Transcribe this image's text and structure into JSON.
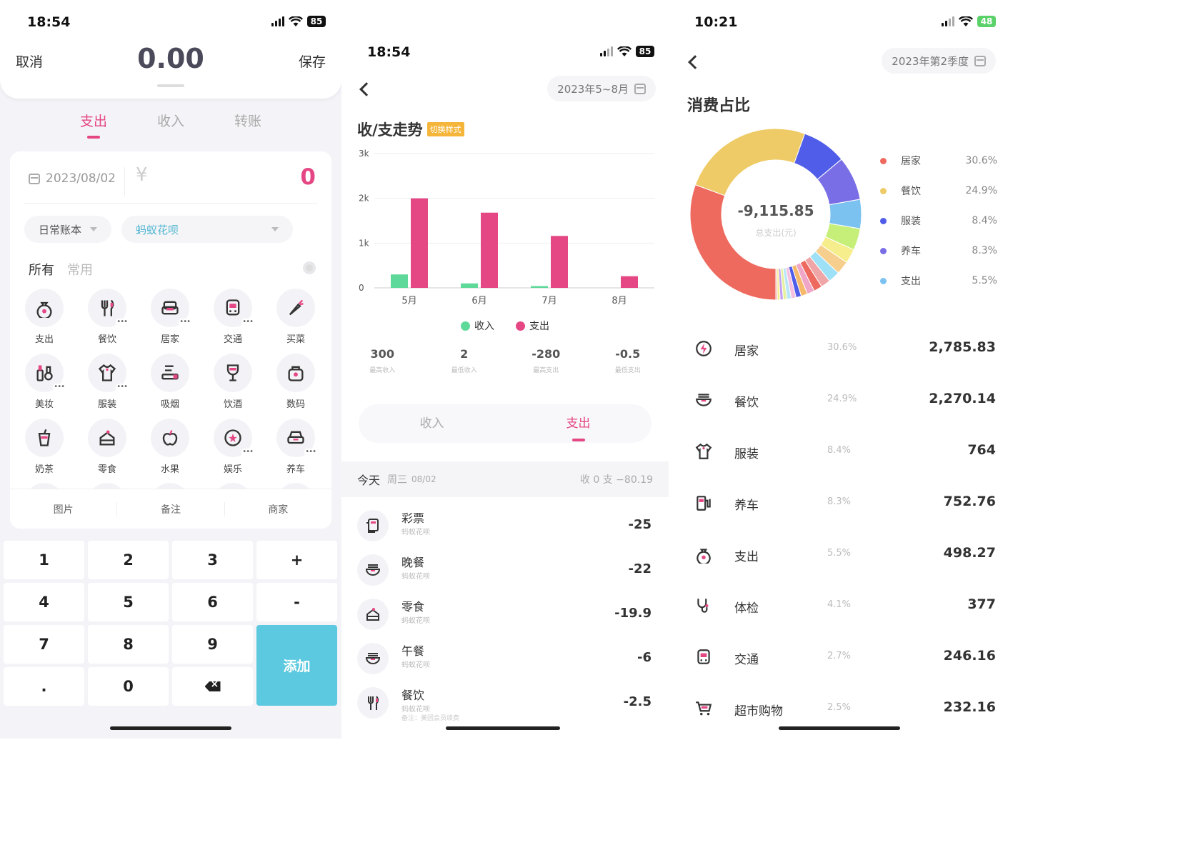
{
  "screen1": {
    "status_time": "18:54",
    "battery": "85",
    "cancel_label": "取消",
    "amount": "0.00",
    "save_label": "保存",
    "tabs": [
      {
        "label": "支出",
        "active": true
      },
      {
        "label": "收入",
        "active": false
      },
      {
        "label": "转账",
        "active": false
      }
    ],
    "date": "2023/08/02",
    "currency_symbol": "¥",
    "entry_value": "0",
    "ledger": "日常账本",
    "account": "蚂蚁花呗",
    "account_color": "#4fb6d0",
    "category_tabs": {
      "all": "所有",
      "common": "常用"
    },
    "categories": [
      {
        "label": "支出",
        "icon": "money-bag-icon",
        "more": false
      },
      {
        "label": "餐饮",
        "icon": "fork-knife-icon",
        "more": true
      },
      {
        "label": "居家",
        "icon": "sofa-icon",
        "more": true
      },
      {
        "label": "交通",
        "icon": "bus-icon",
        "more": true
      },
      {
        "label": "买菜",
        "icon": "carrot-icon",
        "more": false
      },
      {
        "label": "美妆",
        "icon": "cosmetics-icon",
        "more": true
      },
      {
        "label": "服装",
        "icon": "shirt-icon",
        "more": true
      },
      {
        "label": "吸烟",
        "icon": "cigarette-icon",
        "more": false
      },
      {
        "label": "饮酒",
        "icon": "wine-glass-icon",
        "more": false
      },
      {
        "label": "数码",
        "icon": "camera-bag-icon",
        "more": false
      },
      {
        "label": "奶茶",
        "icon": "milk-tea-icon",
        "more": false
      },
      {
        "label": "零食",
        "icon": "cake-icon",
        "more": false
      },
      {
        "label": "水果",
        "icon": "apple-icon",
        "more": false
      },
      {
        "label": "娱乐",
        "icon": "star-circle-icon",
        "more": true
      },
      {
        "label": "养车",
        "icon": "car-icon",
        "more": true
      }
    ],
    "footer": {
      "image": "图片",
      "note": "备注",
      "merchant": "商家"
    },
    "keypad": [
      "1",
      "2",
      "3",
      "+",
      "4",
      "5",
      "6",
      "-",
      "7",
      "8",
      "9",
      ".",
      "0"
    ],
    "add_label": "添加",
    "accent_color": "#e54785"
  },
  "screen2": {
    "status_time": "18:54",
    "battery": "85",
    "date_range": "2023年5~8月",
    "title": "收/支走势",
    "switch_tag": "切换样式",
    "stats": [
      {
        "value": "300",
        "label": "最高收入"
      },
      {
        "value": "2",
        "label": "最低收入"
      },
      {
        "value": "-280",
        "label": "最高支出"
      },
      {
        "value": "-0.5",
        "label": "最低支出"
      }
    ],
    "segments": [
      {
        "label": "收入",
        "active": false
      },
      {
        "label": "支出",
        "active": true
      }
    ],
    "day": {
      "today": "今天",
      "weekday": "周三",
      "date": "08/02",
      "summary": "收 0    支 −80.19"
    },
    "transactions": [
      {
        "name": "彩票",
        "account": "蚂蚁花呗",
        "amount": "-25",
        "icon": "lottery-ticket-icon",
        "note": ""
      },
      {
        "name": "晚餐",
        "account": "蚂蚁花呗",
        "amount": "-22",
        "icon": "bowl-icon",
        "note": ""
      },
      {
        "name": "零食",
        "account": "蚂蚁花呗",
        "amount": "-19.9",
        "icon": "cake-icon",
        "note": ""
      },
      {
        "name": "午餐",
        "account": "蚂蚁花呗",
        "amount": "-6",
        "icon": "bowl-icon",
        "note": ""
      },
      {
        "name": "餐饮",
        "account": "蚂蚁花呗",
        "amount": "-2.5",
        "icon": "fork-knife-icon",
        "note": "备注：美团会员续费"
      }
    ]
  },
  "chart_data": {
    "type": "bar",
    "categories": [
      "5月",
      "6月",
      "7月",
      "8月"
    ],
    "series": [
      {
        "name": "收入",
        "color": "#5fd99a",
        "values": [
          300,
          100,
          40,
          0
        ]
      },
      {
        "name": "支出",
        "color": "#e54785",
        "values": [
          2000,
          1680,
          1160,
          260
        ]
      }
    ],
    "yticks": [
      "0",
      "1k",
      "2k",
      "3k"
    ],
    "ylim": [
      0,
      3000
    ]
  },
  "screen3": {
    "status_time": "10:21",
    "battery": "48",
    "date_range": "2023年第2季度",
    "title": "消费占比",
    "total": "-9,115.85",
    "total_label": "总支出(元)",
    "legend": [
      {
        "name": "居家",
        "pct": "30.6%",
        "color": "#ee6a5f"
      },
      {
        "name": "餐饮",
        "pct": "24.9%",
        "color": "#eecb66"
      },
      {
        "name": "服装",
        "pct": "8.4%",
        "color": "#4f5de8"
      },
      {
        "name": "养车",
        "pct": "8.3%",
        "color": "#7a6ee6"
      },
      {
        "name": "支出",
        "pct": "5.5%",
        "color": "#7cc2f0"
      }
    ],
    "donut_slices": [
      {
        "value": 30.6,
        "color": "#ee6a5f"
      },
      {
        "value": 24.9,
        "color": "#eecb66"
      },
      {
        "value": 8.4,
        "color": "#4f5de8"
      },
      {
        "value": 8.3,
        "color": "#7a6ee6"
      },
      {
        "value": 5.5,
        "color": "#7cc2f0"
      },
      {
        "value": 4.1,
        "color": "#c6ef7a"
      },
      {
        "value": 2.7,
        "color": "#f6ee8c"
      },
      {
        "value": 2.5,
        "color": "#f6cf8e"
      },
      {
        "value": 2.2,
        "color": "#9ee0f6"
      },
      {
        "value": 1.8,
        "color": "#f0a6a6"
      },
      {
        "value": 1.6,
        "color": "#ee6a5f"
      },
      {
        "value": 1.4,
        "color": "#f0a6c6"
      },
      {
        "value": 1.2,
        "color": "#f6b86a"
      },
      {
        "value": 1.0,
        "color": "#4f5de8"
      },
      {
        "value": 0.9,
        "color": "#f6c0e0"
      },
      {
        "value": 0.8,
        "color": "#b8e6f6"
      },
      {
        "value": 0.7,
        "color": "#e6f0a0"
      },
      {
        "value": 0.6,
        "color": "#c0a0f0"
      },
      {
        "value": 0.5,
        "color": "#f6ee8c"
      },
      {
        "value": 0.3,
        "color": "#f0a6a6"
      }
    ],
    "ranking": [
      {
        "name": "居家",
        "pct": "30.6%",
        "amount": "2,785.83",
        "icon": "lightning-icon"
      },
      {
        "name": "餐饮",
        "pct": "24.9%",
        "amount": "2,270.14",
        "icon": "bowl-icon"
      },
      {
        "name": "服装",
        "pct": "8.4%",
        "amount": "764",
        "icon": "shirt-icon"
      },
      {
        "name": "养车",
        "pct": "8.3%",
        "amount": "752.76",
        "icon": "fuel-pump-icon"
      },
      {
        "name": "支出",
        "pct": "5.5%",
        "amount": "498.27",
        "icon": "money-bag-icon"
      },
      {
        "name": "体检",
        "pct": "4.1%",
        "amount": "377",
        "icon": "stethoscope-icon"
      },
      {
        "name": "交通",
        "pct": "2.7%",
        "amount": "246.16",
        "icon": "bus-icon"
      },
      {
        "name": "超市购物",
        "pct": "2.5%",
        "amount": "232.16",
        "icon": "shopping-cart-icon"
      }
    ]
  }
}
